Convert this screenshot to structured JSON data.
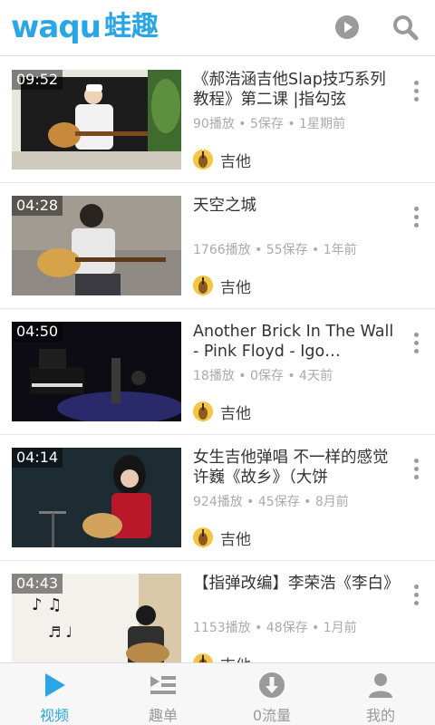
{
  "app": {
    "logo_latin": "waqu",
    "logo_cn": "蛙趣"
  },
  "colors": {
    "accent": "#2aa6e6",
    "icon_gray": "#9a9a9a",
    "meta_gray": "#aaaaaa"
  },
  "header": {
    "play_icon": "play-circle-icon",
    "search_icon": "search-icon"
  },
  "videos": [
    {
      "duration": "09:52",
      "title": "《郝浩涵吉他Slap技巧系列教程》第二课 |指勾弦",
      "meta": "90播放 • 5保存 • 1星期前",
      "channel": "吉他"
    },
    {
      "duration": "04:28",
      "title": "天空之城",
      "meta": "1766播放 • 55保存 • 1年前",
      "channel": "吉他"
    },
    {
      "duration": "04:50",
      "title": "Another Brick In The Wall - Pink Floyd - Igo…",
      "meta": "18播放 • 0保存 • 4天前",
      "channel": "吉他"
    },
    {
      "duration": "04:14",
      "title": "女生吉他弹唱 不一样的感觉 许巍《故乡》（大饼",
      "meta": "924播放 • 45保存 • 8月前",
      "channel": "吉他"
    },
    {
      "duration": "04:43",
      "title": "【指弹改编】李荣浩《李白》",
      "meta": "1153播放 • 48保存 • 1月前",
      "channel": "吉他"
    }
  ],
  "tabs": [
    {
      "label": "视频",
      "icon": "play-triangle-icon",
      "active": true
    },
    {
      "label": "趣单",
      "icon": "playlist-icon",
      "active": false
    },
    {
      "label": "0流量",
      "icon": "download-circle-icon",
      "active": false
    },
    {
      "label": "我的",
      "icon": "user-icon",
      "active": false
    }
  ]
}
